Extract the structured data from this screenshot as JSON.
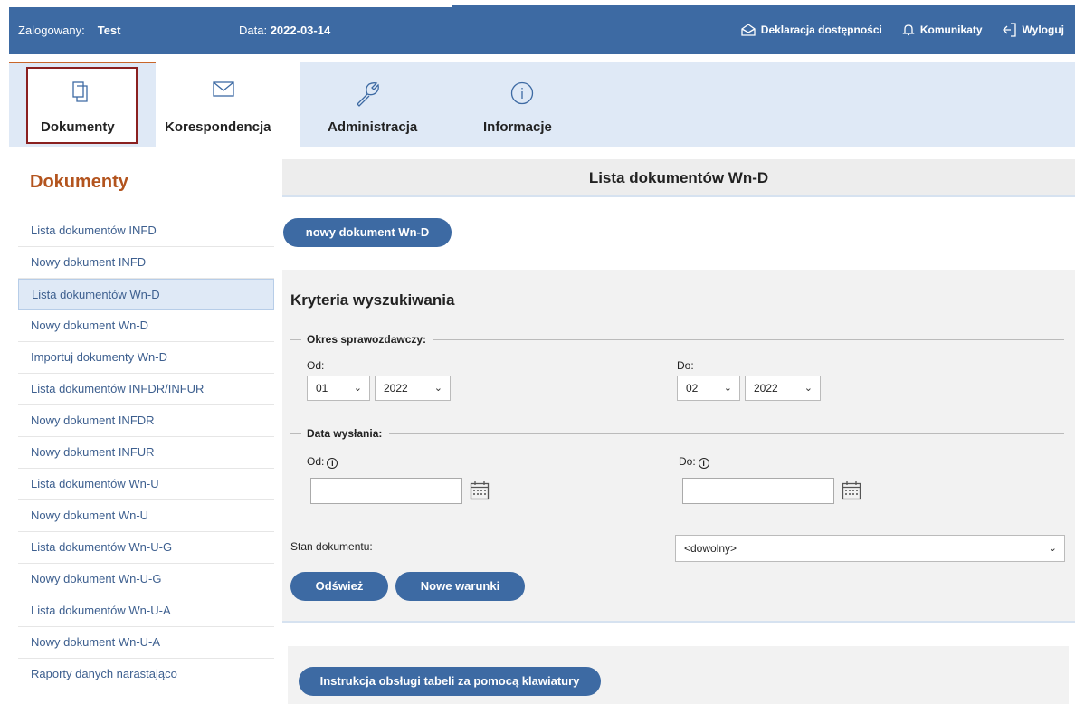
{
  "topbar": {
    "login_label": "Zalogowany:",
    "user": "Test",
    "date_label": "Data:",
    "date_value": "2022-03-14",
    "links": {
      "accessibility": "Deklaracja dostępności",
      "messages": "Komunikaty",
      "logout": "Wyloguj"
    }
  },
  "nav": {
    "tabs": [
      {
        "label": "Dokumenty",
        "icon": "documents-icon"
      },
      {
        "label": "Korespondencja",
        "icon": "envelope-icon"
      },
      {
        "label": "Administracja",
        "icon": "wrench-icon"
      },
      {
        "label": "Informacje",
        "icon": "info-icon"
      }
    ],
    "active": "Dokumenty"
  },
  "sidebar": {
    "title": "Dokumenty",
    "items": [
      "Lista dokumentów INFD",
      "Nowy dokument INFD",
      "Lista dokumentów Wn-D",
      "Nowy dokument Wn-D",
      "Importuj dokumenty Wn-D",
      "Lista dokumentów INFDR/INFUR",
      "Nowy dokument INFDR",
      "Nowy dokument INFUR",
      "Lista dokumentów Wn-U",
      "Nowy dokument Wn-U",
      "Lista dokumentów Wn-U-G",
      "Nowy dokument Wn-U-G",
      "Lista dokumentów Wn-U-A",
      "Nowy dokument Wn-U-A",
      "Raporty danych narastająco"
    ],
    "active_index": 2
  },
  "main": {
    "title": "Lista dokumentów Wn-D",
    "new_button": "nowy dokument Wn-D",
    "search": {
      "title": "Kryteria wyszukiwania",
      "period_legend": "Okres sprawozdawczy:",
      "from_label": "Od:",
      "to_label": "Do:",
      "from_month": "01",
      "from_year": "2022",
      "to_month": "02",
      "to_year": "2022",
      "sent_legend": "Data wysłania:",
      "sent_from_label": "Od:",
      "sent_to_label": "Do:",
      "sent_from_value": "",
      "sent_to_value": "",
      "status_label": "Stan dokumentu:",
      "status_value": "<dowolny>",
      "refresh_button": "Odśwież",
      "new_conditions_button": "Nowe warunki"
    },
    "instruction_button": "Instrukcja obsługi tabeli za pomocą klawiatury"
  },
  "colors": {
    "topbar": "#3d6aa3",
    "nav_bg": "#dfe9f6",
    "sidebar_title": "#b3541e",
    "active_tab_border": "#8a2020",
    "button": "#3d6aa3"
  }
}
